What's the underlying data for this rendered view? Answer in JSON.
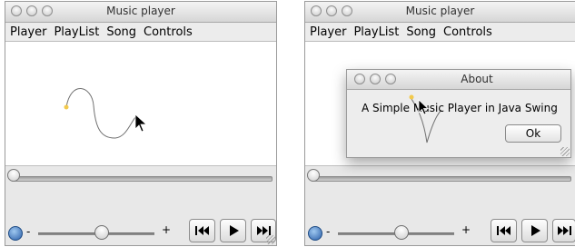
{
  "windows": [
    {
      "title": "Music player",
      "menu": [
        "Player",
        "PlayList",
        "Song",
        "Controls"
      ],
      "volume": {
        "minus_label": "-",
        "plus_label": "+",
        "level": 0.55
      },
      "position_fraction": 0.0
    },
    {
      "title": "Music player",
      "menu": [
        "Player",
        "PlayList",
        "Song",
        "Controls"
      ],
      "volume": {
        "minus_label": "-",
        "plus_label": "+",
        "level": 0.55
      },
      "position_fraction": 0.0
    }
  ],
  "dialog": {
    "title": "About",
    "message": "A Simple Music Player in Java Swing",
    "ok_label": "Ok"
  },
  "icons": {
    "window_controls": [
      "close-icon",
      "minimize-icon",
      "zoom-icon"
    ],
    "transport": [
      "rewind-icon",
      "play-icon",
      "fast-forward-icon"
    ],
    "volume": "volume-icon"
  },
  "colors": {
    "curve_dot": "#f2c94c",
    "curve_stroke": "#707070"
  }
}
